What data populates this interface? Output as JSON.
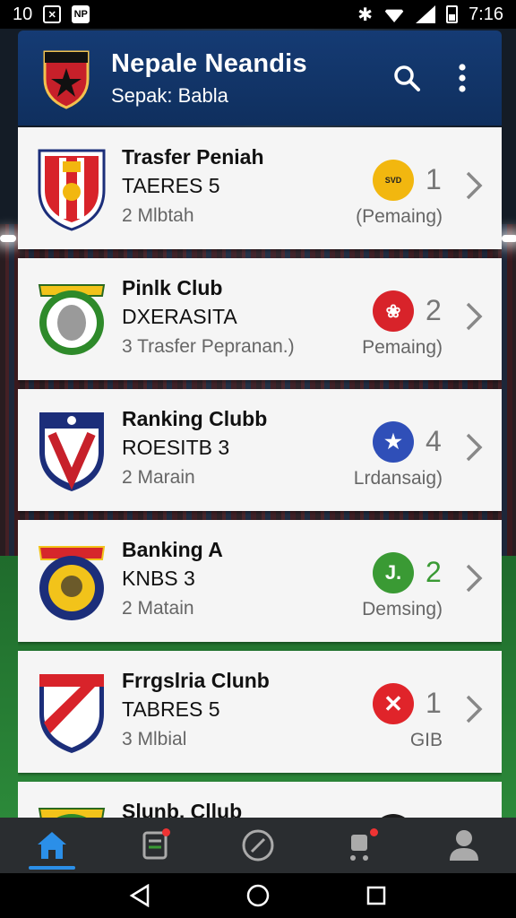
{
  "status_bar": {
    "left_number": "10",
    "np_label": "NP",
    "time": "7:16"
  },
  "header": {
    "title": "Nepale Neandis",
    "subtitle": "Sepak: Babla",
    "logo_icon": "club-crest-star-icon",
    "actions": [
      "search-icon",
      "more-vert-icon"
    ]
  },
  "clubs": [
    {
      "name": "Trasfer Peniah",
      "line2": "TAERES 5",
      "line3": "2 Mlbtah",
      "count": "1",
      "state": "(Pemaing)",
      "badge_text": "SVD",
      "badge_color": "#f2b70f",
      "count_color": "#777777"
    },
    {
      "name": "Pinlk Club",
      "line2": "DXERASITA",
      "line3": "3 Trasfer Pepranan.)",
      "count": "2",
      "state": "Pemaing)",
      "badge_text": "",
      "badge_color": "#d8232a",
      "count_color": "#777777"
    },
    {
      "name": "Ranking Clubb",
      "line2": "ROESITB 3",
      "line3": "2 Marain",
      "count": "4",
      "state": "Lrdansaig)",
      "badge_text": "",
      "badge_color": "#2f4fb8",
      "count_color": "#777777"
    },
    {
      "name": "Banking A",
      "line2": "KNBS 3",
      "line3": "2 Matain",
      "count": "2",
      "state": "Demsing)",
      "badge_text": "J.",
      "badge_color": "#3a9a34",
      "count_color": "#3a9a34"
    },
    {
      "name": "Frrgslria Clunb",
      "line2": "TABRES 5",
      "line3": "3 Mlbial",
      "count": "1",
      "state": "GIB",
      "badge_text": "",
      "badge_color": "#e0242a",
      "count_color": "#777777"
    },
    {
      "name": "Slunb, Cllub",
      "line2": "",
      "line3": "",
      "count": "",
      "state": "",
      "badge_text": "",
      "badge_color": "#1b1b1b",
      "count_color": "#777777"
    }
  ],
  "bottom_nav": [
    "home-icon",
    "transfer-list-icon",
    "match-ball-icon",
    "notifications-icon",
    "profile-icon"
  ],
  "system_nav": [
    "back-icon",
    "home-circle-icon",
    "recents-icon"
  ],
  "colors": {
    "header_bg": "#153b74",
    "active_tab": "#2b8fe8",
    "card_bg": "#f5f5f5"
  }
}
